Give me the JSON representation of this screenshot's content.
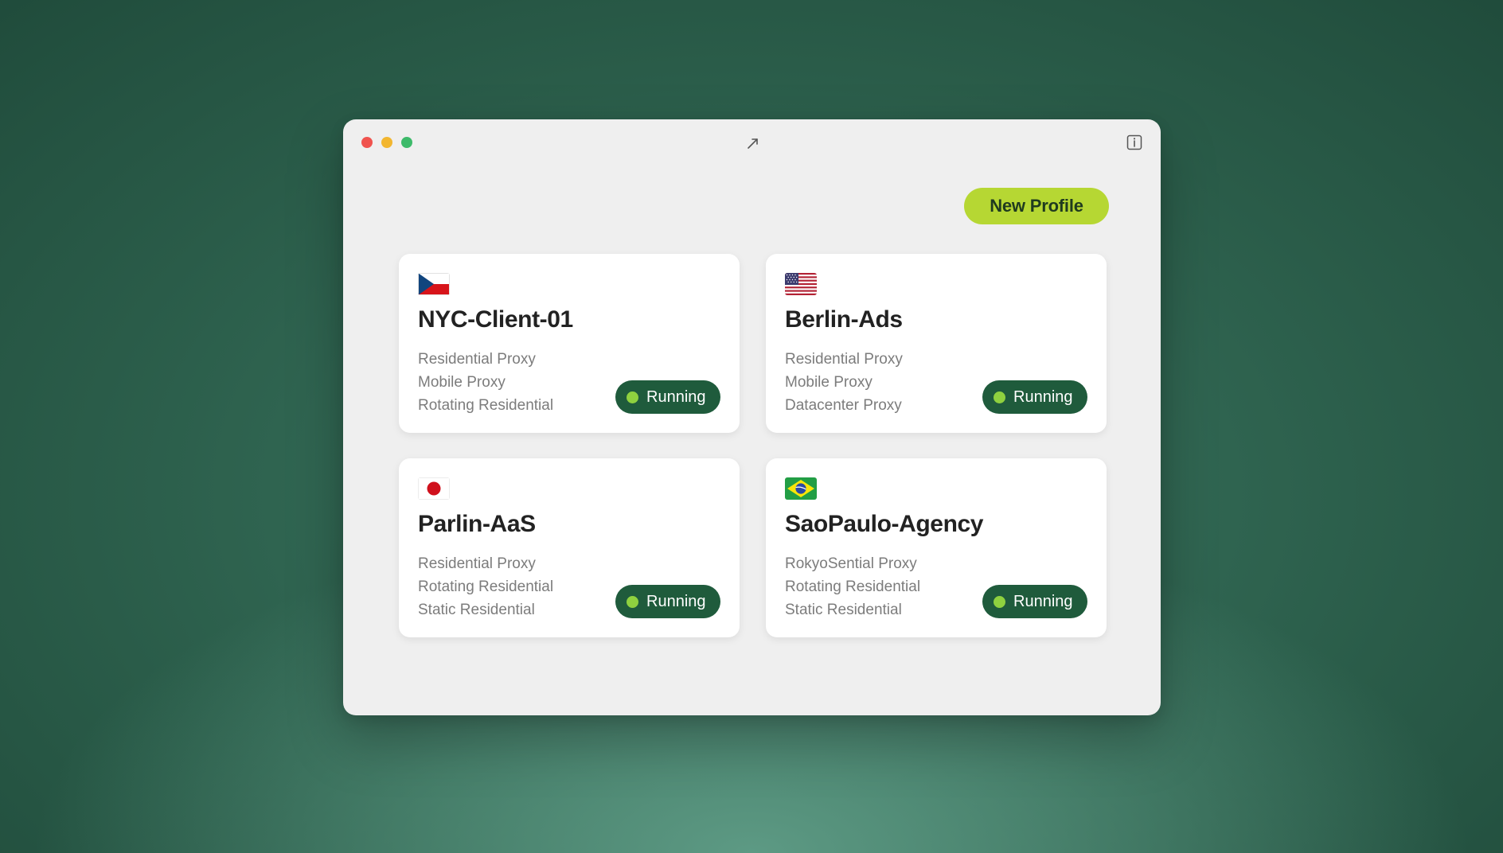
{
  "toolbar": {
    "new_profile_label": "New Profile"
  },
  "window": {
    "controls": [
      "close-icon",
      "minimize-icon",
      "maximize-icon"
    ],
    "center_icon": "resize-arrow-icon",
    "right_icon": "info-icon"
  },
  "colors": {
    "accent": "#b6d733",
    "status_bg": "#1f5b3c",
    "status_dot": "#8fd13f",
    "window_bg": "#efefef"
  },
  "profiles": [
    {
      "flag": "czech-flag-icon",
      "name": "NYC-Client-01",
      "proxies": [
        "Residential Proxy",
        "Mobile Proxy",
        "Rotating Residential"
      ],
      "status": "Running"
    },
    {
      "flag": "usa-flag-icon",
      "name": "Berlin-Ads",
      "proxies": [
        "Residential Proxy",
        "Mobile Proxy",
        "Datacenter Proxy"
      ],
      "status": "Running"
    },
    {
      "flag": "japan-flag-icon",
      "name": "Parlin-AaS",
      "proxies": [
        "Residential Proxy",
        "Rotating Residential",
        "Static Residential"
      ],
      "status": "Running"
    },
    {
      "flag": "brazil-flag-icon",
      "name": "SaoPaulo-Agency",
      "proxies": [
        "RokyoSential Proxy",
        "Rotating Residential",
        "Static Residential"
      ],
      "status": "Running"
    }
  ]
}
